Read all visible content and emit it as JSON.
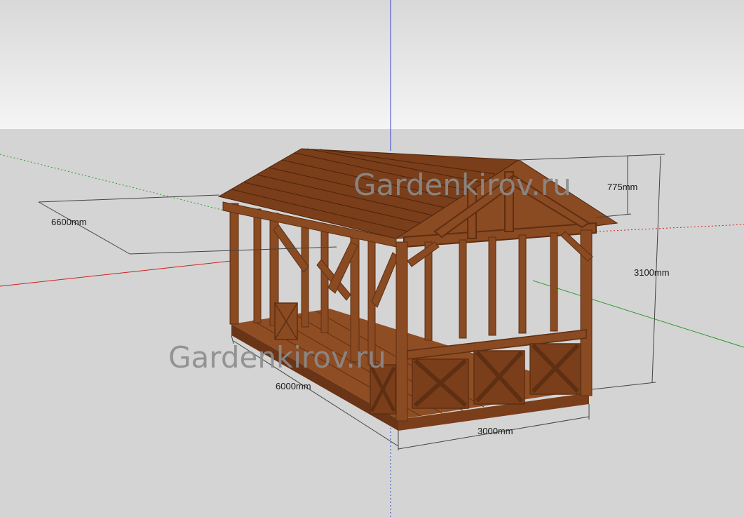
{
  "watermarks": [
    "Gardenkirov.ru",
    "Gardenkirov.ru"
  ],
  "dimensions": {
    "ridge_height": "775mm",
    "total_height": "3100mm",
    "roof_length": "6600mm",
    "floor_length": "6000mm",
    "width": "3000mm"
  },
  "colors": {
    "sky_top": "#dcdcdc",
    "sky_bottom": "#f4f4f4",
    "ground": "#d4d4d4",
    "wood": "#8a4a22",
    "wood_dark": "#5e2f12",
    "wood_light": "#a35a2b",
    "axis_red": "#d02020",
    "axis_green": "#2a9a2a",
    "axis_blue": "#3344cc",
    "dim_line": "#444444"
  }
}
